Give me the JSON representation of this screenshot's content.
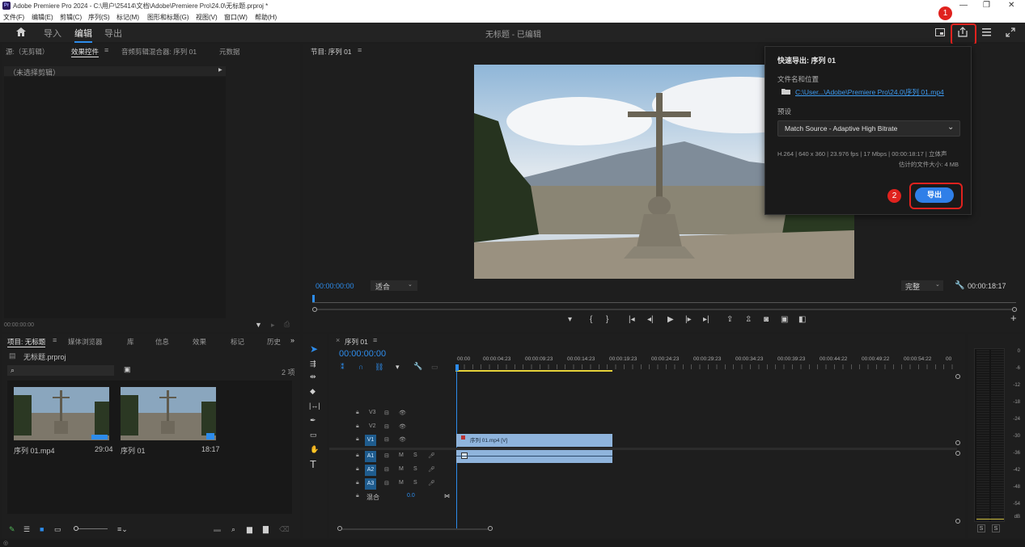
{
  "window": {
    "app_badge": "Pr",
    "title": "Adobe Premiere Pro 2024 - C:\\用户\\25414\\文档\\Adobe\\Premiere Pro\\24.0\\无标题.prproj *",
    "minimize": "—",
    "maximize": "❐",
    "close": "✕"
  },
  "menu": [
    "文件(F)",
    "编辑(E)",
    "剪辑(C)",
    "序列(S)",
    "标记(M)",
    "图形和标题(G)",
    "视图(V)",
    "窗口(W)",
    "帮助(H)"
  ],
  "header": {
    "tabs": [
      "导入",
      "编辑",
      "导出"
    ],
    "active_tab": "编辑",
    "center_title": "无标题 - 已编辑"
  },
  "source_panel": {
    "tabs": [
      "源:（无剪辑）",
      "效果控件",
      "音频剪辑混合器: 序列 01",
      "元数据"
    ],
    "active_tab": "效果控件",
    "no_clip": "（未选择剪辑）",
    "timecode": "00:00:00:00"
  },
  "program_monitor": {
    "tab": "节目: 序列 01",
    "timecode": "00:00:00:00",
    "fit": "适合",
    "quality": "完整",
    "duration": "00:00:18:17"
  },
  "quick_export": {
    "title": "快速导出: 序列 01",
    "file_label": "文件名和位置",
    "file_path": "C:\\User...\\Adobe\\Premiere Pro\\24.0\\序列 01.mp4",
    "preset_label": "预设",
    "preset_value": "Match Source - Adaptive High Bitrate",
    "summary": "H.264 | 640 x 360 | 23.976 fps | 17 Mbps | 00:00:18:17 | 立体声",
    "est_size": "估计的文件大小: 4 MB",
    "export_button": "导出"
  },
  "annotations": [
    "1",
    "2"
  ],
  "project_panel": {
    "tabs": [
      "项目: 无标题",
      "媒体浏览器",
      "库",
      "信息",
      "效果",
      "标记",
      "历史"
    ],
    "active_tab": "项目: 无标题",
    "project_file": "无标题.prproj",
    "item_count": "2 项",
    "items": [
      {
        "name": "序列 01.mp4",
        "duration": "29:04"
      },
      {
        "name": "序列 01",
        "duration": "18:17"
      }
    ]
  },
  "timeline": {
    "tab": "序列 01",
    "timecode": "00:00:00:00",
    "ruler": [
      "00:00",
      "00:00:04:23",
      "00:00:09:23",
      "00:00:14:23",
      "00:00:19:23",
      "00:00:24:23",
      "00:00:29:23",
      "00:00:34:23",
      "00:00:39:23",
      "00:00:44:22",
      "00:00:49:22",
      "00:00:54:22",
      "00"
    ],
    "video_tracks": [
      "V3",
      "V2",
      "V1"
    ],
    "audio_tracks": [
      "A1",
      "A2",
      "A3"
    ],
    "mix_label": "混合",
    "mix_value": "0.0",
    "clip_label": "序列 01.mp4 [V]"
  },
  "meter": {
    "scale": [
      "0",
      "-6",
      "-12",
      "-18",
      "-24",
      "-30",
      "-36",
      "-42",
      "-48",
      "-54",
      "dB"
    ],
    "solo": [
      "S",
      "S"
    ]
  },
  "icons": {
    "home": "home-icon",
    "share": "share-icon"
  }
}
